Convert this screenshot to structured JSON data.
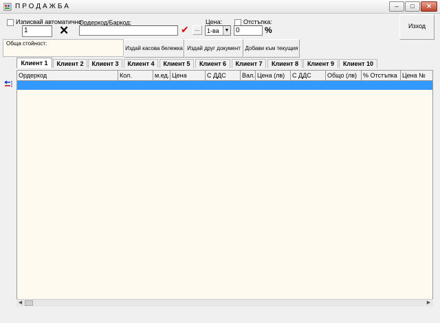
{
  "window": {
    "title": "ПРОДАЖБА",
    "minimize": "–",
    "maximize": "□",
    "close": "✕"
  },
  "toolbar": {
    "auto_write_label": "Изписвай автоматично",
    "quantity_value": "1",
    "clear_icon": "✕",
    "barcode_label": "Ордеркод/Баркод:",
    "barcode_value": "",
    "confirm_icon": "✔",
    "browse_label": "...",
    "price_label": "Цена:",
    "price_value": "1-ва",
    "discount_label": "Отстъпка:",
    "discount_value": "0",
    "percent_sign": "%",
    "exit_label": "Изход"
  },
  "totals": {
    "label": "Обща стойност:",
    "value": "",
    "btn_receipt": "Издай касова бележка",
    "btn_other_doc": "Издай друг документ",
    "btn_add_current": "Добави към текущия"
  },
  "tabs": [
    "Клиент 1",
    "Клиент 2",
    "Клиент 3",
    "Клиент 4",
    "Клиент 5",
    "Клиент 6",
    "Клиент 7",
    "Клиент 8",
    "Клиент 9",
    "Клиент 10"
  ],
  "grid": {
    "columns": [
      "Ордеркод",
      "Кол.",
      "м.ед.",
      "Цена",
      "С ДДС",
      "Вал.",
      "Цена (лв)",
      "С ДДС",
      "Общо (лв)",
      "% Отстъпка",
      "Цена №"
    ]
  },
  "colors": {
    "selection": "#3399ff",
    "grid_bg": "#fffaef",
    "close_btn": "#c0432c"
  }
}
